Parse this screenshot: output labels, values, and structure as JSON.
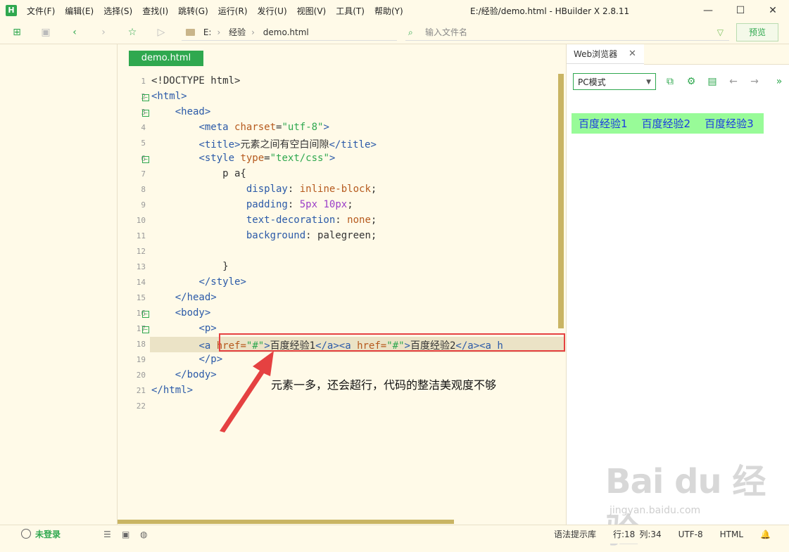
{
  "app": {
    "logo_letter": "H",
    "window_title": "E:/经验/demo.html - HBuilder X 2.8.11",
    "menu": [
      "文件(F)",
      "编辑(E)",
      "选择(S)",
      "查找(I)",
      "跳转(G)",
      "运行(R)",
      "发行(U)",
      "视图(V)",
      "工具(T)",
      "帮助(Y)"
    ],
    "window_buttons": [
      "—",
      "☐",
      "✕"
    ]
  },
  "toolbar": {
    "breadcrumb": [
      "E:",
      "经验",
      "demo.html"
    ],
    "search_placeholder": "输入文件名",
    "preview_label": "预览"
  },
  "editor": {
    "tab_label": "demo.html",
    "line_numbers": [
      "1",
      "2",
      "3",
      "4",
      "5",
      "6",
      "7",
      "8",
      "9",
      "10",
      "11",
      "12",
      "13",
      "14",
      "15",
      "16",
      "17",
      "18",
      "19",
      "20",
      "21",
      "22"
    ],
    "annotation": "元素一多，还会超行，代码的整洁美观度不够",
    "line18": {
      "indent": "        ",
      "a1_open": "<a ",
      "a1_href": "href=",
      "a1_val": "\"#\"",
      "a1_close": ">",
      "a1_text": "百度经验1",
      "a1_end": "</a>",
      "a2_open": "<a ",
      "a2_href": "href=",
      "a2_val": "\"#\"",
      "a2_close": ">",
      "a2_text": "百度经验2",
      "a2_end": "</a>",
      "a3_open": "<a h"
    }
  },
  "browser": {
    "tab_label": "Web浏览器",
    "mode_select": "PC模式",
    "links": [
      "百度经验1",
      "百度经验2",
      "百度经验3"
    ],
    "watermark": "Bai du 经验",
    "watermark_url": "jingyan.baidu.com"
  },
  "statusbar": {
    "login": "未登录",
    "syntax_hint": "语法提示库",
    "position": "行:18",
    "column": "列:34",
    "encoding": "UTF-8",
    "language": "HTML"
  },
  "colors": {
    "accent": "#2fa84f",
    "annotation_red": "#e54141",
    "link_bg": "#98fb98"
  }
}
